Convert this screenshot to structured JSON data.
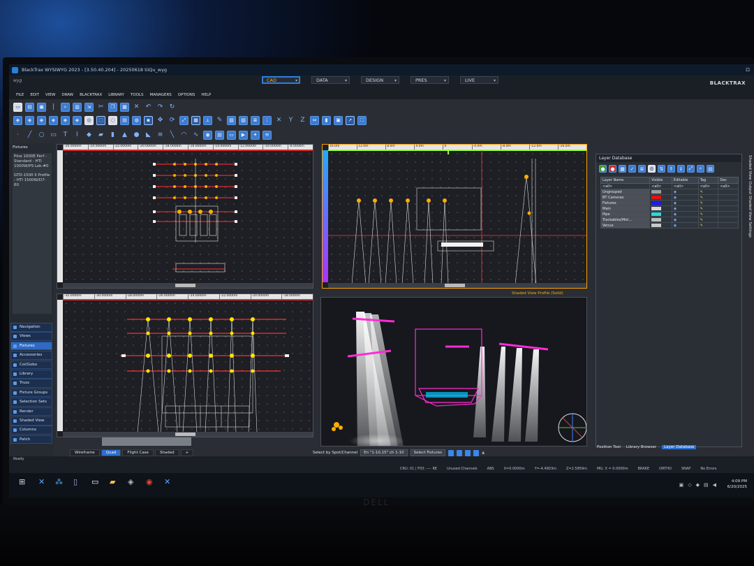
{
  "window": {
    "title": "BlackTrax WYSIWYG 2023 - [3.50.40.204] - 20250618 tiiQu_wyg",
    "logo": "wyg",
    "brand": "BLACKTRAX"
  },
  "modes": [
    "CAD",
    "DATA",
    "DESIGN",
    "PRES",
    "LIVE"
  ],
  "menu": [
    "FILE",
    "EDIT",
    "VIEW",
    "DRAW",
    "BLACKTRAX",
    "LIBRARY",
    "TOOLS",
    "MANAGERS",
    "OPTIONS",
    "HELP"
  ],
  "fixtures_panel": {
    "title": "Fixtures",
    "items": [
      "Pine 1000E Perf - Standard - HTI 1000W/PS Lok-#0",
      "GTD-1500 II Profile - HTI 1500W/D7-60"
    ]
  },
  "navigation": [
    "Navigation",
    "Views",
    "Fixtures",
    "Accessories",
    "Col/Gobo",
    "Library",
    "Truss",
    "Fixture Groups",
    "Selection Sets",
    "Render",
    "Shaded View",
    "Columns",
    "Patch"
  ],
  "viewport_tabs": [
    "Wireframe",
    "Quad",
    "Flight Case",
    "Shaded",
    "+"
  ],
  "viewports": {
    "top_left": {
      "ruler": [
        "-26.0000m",
        "-24.0000m",
        "-22.0000m",
        "-20.0000m",
        "-18.0000m",
        "-16.0000m",
        "-14.0000m",
        "-12.0000m",
        "-10.0000m",
        "-8.0000m"
      ]
    },
    "top_right": {
      "ruler": [
        "16.0m",
        "12.0m",
        "8.0m",
        "4.0m",
        "0",
        "-4.0m",
        "-8.0m",
        "-12.0m",
        "-16.0m"
      ],
      "label": "Shaded View Profile (Solid)"
    },
    "bottom_left": {
      "ruler": [
        "-32.0000m",
        "-30.0000m",
        "-28.0000m",
        "-26.0000m",
        "-24.0000m",
        "-22.0000m",
        "-20.0000m",
        "-18.0000m"
      ]
    }
  },
  "selection": {
    "label": "Select by Spot/Channel",
    "value": "En \"1-10,15\" ch 1-10",
    "fixtures_btn": "Select Fixtures"
  },
  "layer_database": {
    "title": "Layer Database",
    "headers": [
      "Layer Name",
      "Visible",
      "Editable",
      "Tag",
      "Dec"
    ],
    "filter_row": [
      "<all>",
      "<all>",
      "<all>",
      "<all>",
      "<all>"
    ],
    "rows": [
      {
        "name": "Ungrouped",
        "color": "#9c9c9c"
      },
      {
        "name": "BT Cameras",
        "color": "#e01212"
      },
      {
        "name": "Fixtures",
        "color": "#1a1aff"
      },
      {
        "name": "Main",
        "color": "#d8d8d8"
      },
      {
        "name": "Pipe",
        "color": "#2ad9d9"
      },
      {
        "name": "Trackables/Mot...",
        "color": "#bdbdbd"
      },
      {
        "name": "Venue",
        "color": "#c8c8c8"
      }
    ],
    "tabs": [
      "Position Tool",
      "Library Browser",
      "Layer Database"
    ],
    "side_tabs": [
      "Shaded View Output",
      "Shaded View Settings"
    ]
  },
  "status": {
    "ready": "Ready",
    "items": [
      "CRU: 01 | F03: ---- RE",
      "Unused Channels",
      "ABS",
      "X=0.0000m",
      "Y=-4.4903m",
      "Z=2.5859m",
      "MG: X = 0.0000m",
      "BRAKE",
      "ORTHO",
      "SNAP",
      "No Errors"
    ]
  },
  "clock": {
    "time": "4:09 PM",
    "date": "6/20/2025"
  },
  "monitor_brand": "DELL",
  "colors": {
    "accent": "#2d6fd0",
    "truss_red": "#e02a2a",
    "beam": "#f1f1f1",
    "magenta": "#ff2bd6",
    "amber": "#ffae00"
  }
}
